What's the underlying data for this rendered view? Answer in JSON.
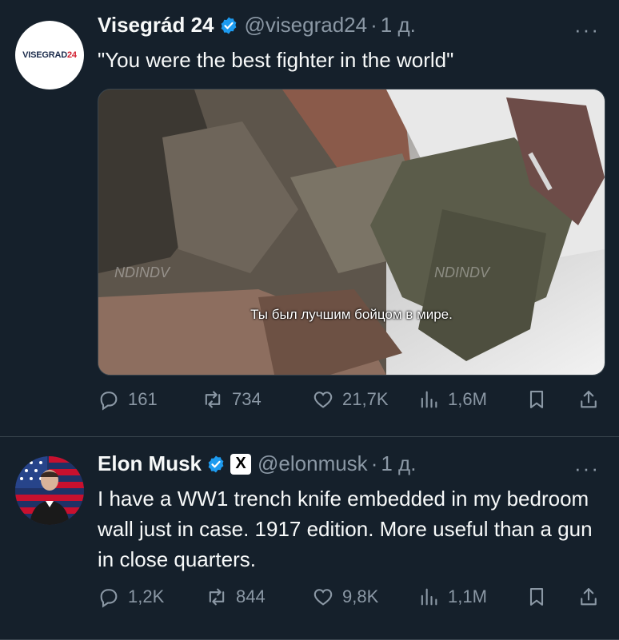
{
  "tweet1": {
    "avatar_text_1": "VISEGRAD",
    "avatar_text_2": "24",
    "name": "Visegrád 24",
    "handle": "@visegrad24",
    "separator": "·",
    "time": "1 д.",
    "more": "···",
    "text": "\"You were the best fighter in the world\"",
    "media": {
      "subtitle": "Ты был лучшим бойцом в мире.",
      "watermark": "NDINDV"
    },
    "replies": "161",
    "reposts": "734",
    "likes": "21,7K",
    "views": "1,6M"
  },
  "tweet2": {
    "name": "Elon Musk",
    "badge": "X",
    "handle": "@elonmusk",
    "separator": "·",
    "time": "1 д.",
    "more": "···",
    "text": "I have a WW1 trench knife embedded in my bedroom wall just in case. 1917 edition. More useful than a gun in close quarters.",
    "replies": "1,2K",
    "reposts": "844",
    "likes": "9,8K",
    "views": "1,1M"
  },
  "colors": {
    "background": "#15202b",
    "text_primary": "#f7f9f9",
    "text_secondary": "#8b98a5",
    "verified": "#1d9bf0",
    "divider": "#38444d"
  },
  "icons": [
    "reply-icon",
    "repost-icon",
    "like-icon",
    "views-icon",
    "bookmark-icon",
    "share-icon",
    "verified-badge-icon",
    "more-icon"
  ]
}
